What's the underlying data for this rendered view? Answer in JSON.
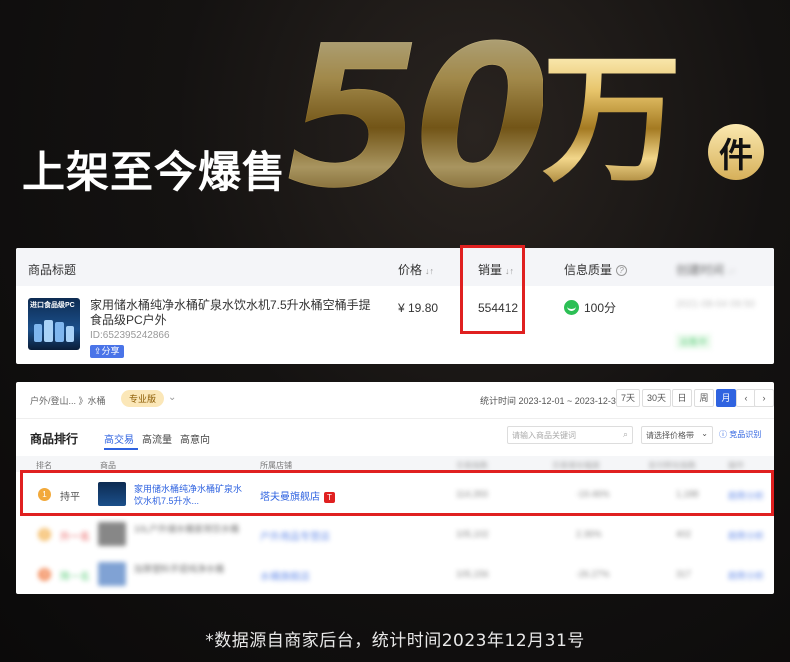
{
  "hero": {
    "title": "上架至今爆售",
    "number": "50",
    "unit": "万",
    "badge": "件"
  },
  "card1": {
    "headers": {
      "title": "商品标题",
      "price": "价格",
      "sales": "销量",
      "quality": "信息质量",
      "time": "创建时间"
    },
    "product": {
      "thumb_label": "进口食品级PC",
      "title": "家用储水桶纯净水桶矿泉水饮水机7.5升水桶空桶手提食品级PC户外",
      "id": "ID:652395242866",
      "share": "分享",
      "price": "¥ 19.80",
      "sales": "554412",
      "quality": "100分",
      "time": "2021-08-04 09:50",
      "status": "出售中"
    }
  },
  "card2": {
    "breadcrumb": "户外/登山... 》水桶",
    "pro_badge": "专业版",
    "date_range": "统计时间 2023-12-01 ~ 2023-12-31",
    "periods": [
      "7天",
      "30天",
      "日",
      "周",
      "月"
    ],
    "active_period": "月",
    "section_title": "商品排行",
    "tabs": [
      "高交易",
      "高流量",
      "高意向"
    ],
    "active_tab": "高交易",
    "search_placeholder": "请输入商品关键词",
    "sort_select": "请选择价格带",
    "help_link": "竞品识别",
    "table_headers": [
      "排名",
      "商品",
      "所属店铺",
      "交易指数",
      "交易增长幅度",
      "支付转化指数",
      "操作"
    ],
    "rows": [
      {
        "rank": "1",
        "trend": "持平",
        "title": "家用储水桶纯净水桶矿泉水饮水机7.5升水...",
        "shop": "塔夫曼旗舰店",
        "shop_badge": "T",
        "v1": "114,393",
        "v2": "-19.46%",
        "v3": "1,188",
        "action": "趋势分析"
      },
      {
        "rank": "2",
        "trend": "升一名",
        "title": "10L户外储水桶家用饮水桶",
        "shop": "户外用品专营店",
        "v1": "105,102",
        "v2": "2.36%",
        "v3": "402",
        "action": "趋势分析"
      },
      {
        "rank": "3",
        "trend": "降一名",
        "title": "加厚塑料手提纯净水桶",
        "shop": "水桶旗舰店",
        "v1": "105,156",
        "v2": "-26.27%",
        "v3": "317",
        "action": "趋势分析"
      }
    ]
  },
  "footer": "*数据源自商家后台，统计时间2023年12月31号",
  "colors": {
    "gold": "#d6b05a",
    "highlight_red": "#e02020",
    "link_blue": "#2f63e0",
    "good_green": "#2cbf55"
  }
}
